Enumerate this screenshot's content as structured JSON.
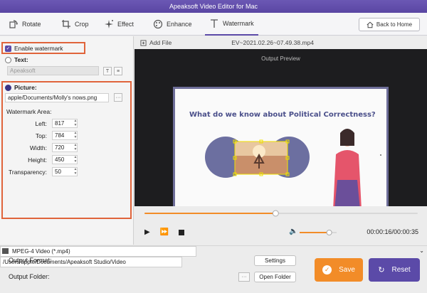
{
  "window": {
    "title": "Apeaksoft Video Editor for Mac"
  },
  "toolbar": {
    "tabs": [
      {
        "label": "Rotate"
      },
      {
        "label": "Crop"
      },
      {
        "label": "Effect"
      },
      {
        "label": "Enhance"
      },
      {
        "label": "Watermark"
      }
    ],
    "back_label": "Back to Home"
  },
  "watermark": {
    "enable_label": "Enable watermark",
    "enable_checked": true,
    "text_label": "Text:",
    "text_value": "Apeaksoft",
    "picture_label": "Picture:",
    "picture_path": "apple/Documents/Molly's nows.png",
    "area_label": "Watermark Area:",
    "fields": [
      {
        "label": "Left:",
        "value": "817"
      },
      {
        "label": "Top:",
        "value": "784"
      },
      {
        "label": "Width:",
        "value": "720"
      },
      {
        "label": "Height:",
        "value": "450"
      },
      {
        "label": "Transparency:",
        "value": "50"
      }
    ]
  },
  "filebar": {
    "add_file_label": "Add File",
    "filename": "EV~2021.02.26~07.49.38.mp4"
  },
  "preview": {
    "title": "Output Preview",
    "slide_title": "What do we know about Political Correctness?"
  },
  "playback": {
    "time": "00:00:16/00:00:35",
    "progress": 0.48,
    "volume": 0.8
  },
  "output": {
    "format_label": "Output Format:",
    "format_value": "MPEG-4 Video (*.mp4)",
    "settings_label": "Settings",
    "folder_label": "Output Folder:",
    "folder_value": "/Users/apple/Documents/Apeaksoft Studio/Video",
    "open_folder_label": "Open Folder",
    "save_label": "Save",
    "reset_label": "Reset"
  },
  "colors": {
    "accent": "#5b4aa8",
    "save": "#f28c28",
    "highlight": "#e0643b"
  }
}
